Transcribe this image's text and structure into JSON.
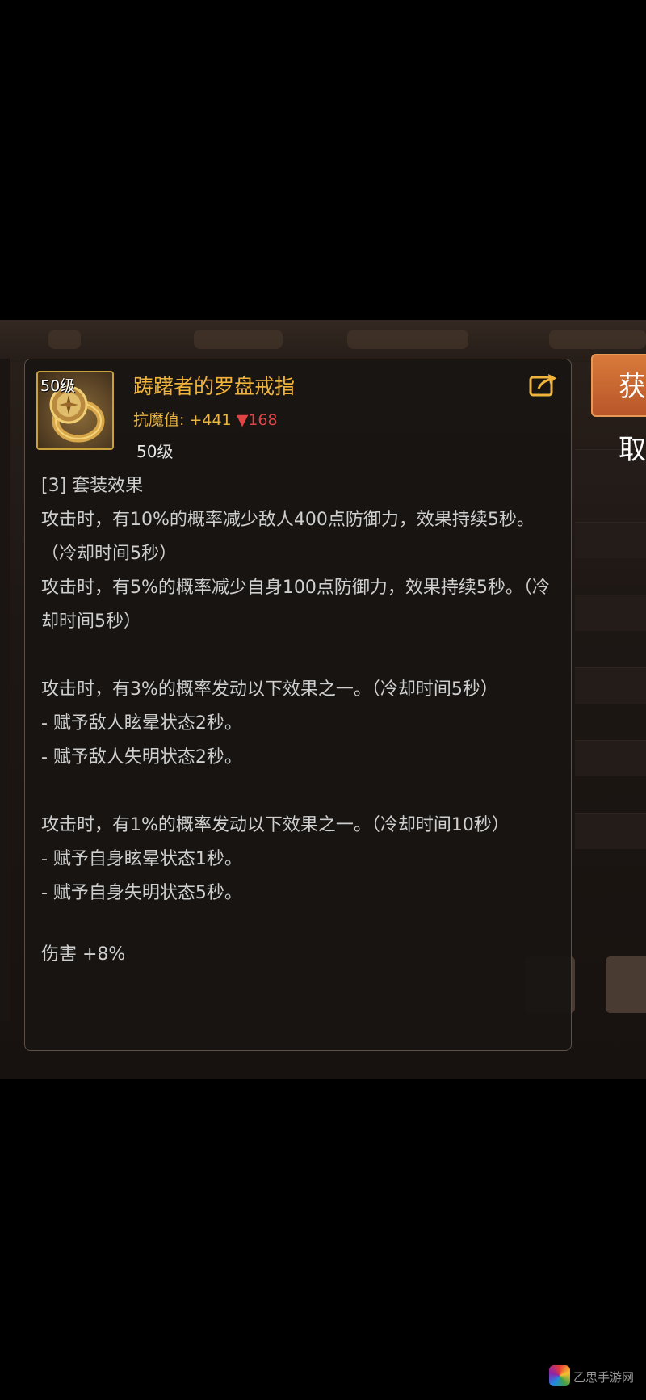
{
  "background": {
    "get_button_label": "获取"
  },
  "tooltip": {
    "level_badge": "50级",
    "item_name": "踌躇者的罗盘戒指",
    "stat_label": "抗魔值:",
    "stat_value": "+441",
    "stat_change": "▼168",
    "level_text": "50级",
    "share_icon": "share-icon",
    "lines": [
      "[3] 套装效果",
      "攻击时，有10%的概率减少敌人400点防御力，效果持续5秒。（冷却时间5秒）",
      "攻击时，有5%的概率减少自身100点防御力，效果持续5秒。（冷却时间5秒）",
      "攻击时，有3%的概率发动以下效果之一。（冷却时间5秒）",
      "- 赋予敌人眩晕状态2秒。",
      "- 赋予敌人失明状态2秒。",
      "攻击时，有1%的概率发动以下效果之一。（冷却时间10秒）",
      "- 赋予自身眩晕状态1秒。",
      "- 赋予自身失明状态5秒。",
      "伤害 +8%"
    ]
  },
  "watermark": {
    "text": "乙思手游网"
  },
  "colors": {
    "item_name": "#f0b33c",
    "stat": "#e9b546",
    "stat_down": "#e04545",
    "body_text": "#cfcfcf"
  }
}
